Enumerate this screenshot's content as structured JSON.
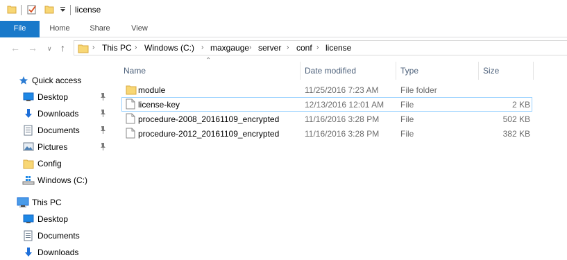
{
  "window": {
    "title": "license"
  },
  "ribbon": {
    "tabs": [
      {
        "label": "File"
      },
      {
        "label": "Home"
      },
      {
        "label": "Share"
      },
      {
        "label": "View"
      }
    ],
    "accent": "#1979ca"
  },
  "address": {
    "crumbs": [
      "This PC",
      "Windows (C:)",
      "maxgauge",
      "server",
      "conf",
      "license"
    ]
  },
  "sidebar": {
    "quick_access": "Quick access",
    "quick_items": [
      {
        "label": "Desktop",
        "icon": "desktop-icon",
        "pinned": true
      },
      {
        "label": "Downloads",
        "icon": "download-icon",
        "pinned": true
      },
      {
        "label": "Documents",
        "icon": "documents-icon",
        "pinned": true
      },
      {
        "label": "Pictures",
        "icon": "pictures-icon",
        "pinned": true
      },
      {
        "label": "Config",
        "icon": "folder-icon",
        "pinned": false
      },
      {
        "label": "Windows (C:)",
        "icon": "drive-icon",
        "pinned": false
      }
    ],
    "this_pc": "This PC",
    "pc_items": [
      {
        "label": "Desktop",
        "icon": "desktop-icon"
      },
      {
        "label": "Documents",
        "icon": "documents-icon"
      },
      {
        "label": "Downloads",
        "icon": "download-icon"
      }
    ]
  },
  "columns": {
    "name": "Name",
    "date": "Date modified",
    "type": "Type",
    "size": "Size"
  },
  "files": [
    {
      "name": "module",
      "date": "11/25/2016 7:23 AM",
      "type": "File folder",
      "size": "",
      "icon": "folder-icon"
    },
    {
      "name": "license-key",
      "date": "12/13/2016 12:01 AM",
      "type": "File",
      "size": "2 KB",
      "icon": "file-icon",
      "selected": true
    },
    {
      "name": "procedure-2008_20161109_encrypted",
      "date": "11/16/2016 3:28 PM",
      "type": "File",
      "size": "502 KB",
      "icon": "file-icon"
    },
    {
      "name": "procedure-2012_20161109_encrypted",
      "date": "11/16/2016 3:28 PM",
      "type": "File",
      "size": "382 KB",
      "icon": "file-icon"
    }
  ]
}
